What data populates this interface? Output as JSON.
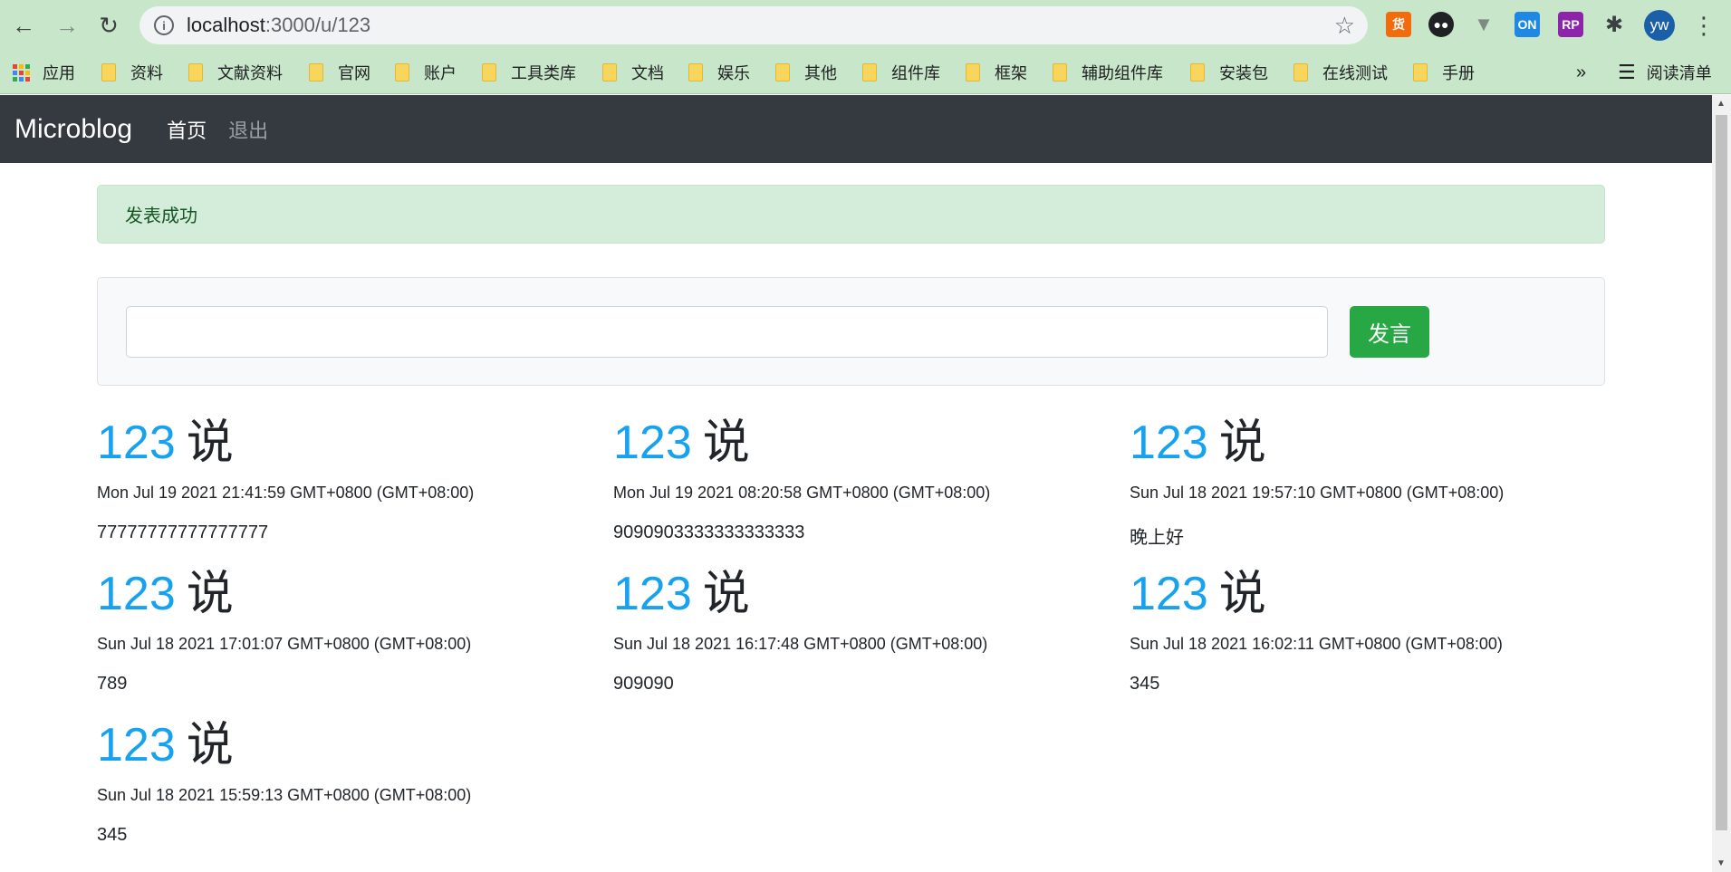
{
  "browser": {
    "url_host": "localhost",
    "url_path": ":3000/u/123",
    "avatar_initials": "yw",
    "extensions": [
      {
        "name": "货",
        "color": "#f26c0d"
      },
      {
        "name": "ON",
        "color": "#1e88e5"
      },
      {
        "name": "RP",
        "color": "#8e24aa"
      }
    ],
    "apps_label": "应用",
    "bookmarks": [
      "资料",
      "文献资料",
      "官网",
      "账户",
      "工具类库",
      "文档",
      "娱乐",
      "其他",
      "组件库",
      "框架",
      "辅助组件库",
      "安装包",
      "在线测试",
      "手册"
    ],
    "more_label": "»",
    "reading_list_label": "阅读清单"
  },
  "navbar": {
    "brand": "Microblog",
    "links": [
      "首页",
      "退出"
    ]
  },
  "alert": {
    "message": "发表成功"
  },
  "post_form": {
    "input_value": "",
    "button_label": "发言"
  },
  "posts": [
    {
      "user": "123",
      "says": "说",
      "time": "Mon Jul 19 2021 21:41:59 GMT+0800 (GMT+08:00)",
      "text": "77777777777777777"
    },
    {
      "user": "123",
      "says": "说",
      "time": "Mon Jul 19 2021 08:20:58 GMT+0800 (GMT+08:00)",
      "text": "9090903333333333333"
    },
    {
      "user": "123",
      "says": "说",
      "time": "Sun Jul 18 2021 19:57:10 GMT+0800 (GMT+08:00)",
      "text": "晚上好"
    },
    {
      "user": "123",
      "says": "说",
      "time": "Sun Jul 18 2021 17:01:07 GMT+0800 (GMT+08:00)",
      "text": "789"
    },
    {
      "user": "123",
      "says": "说",
      "time": "Sun Jul 18 2021 16:17:48 GMT+0800 (GMT+08:00)",
      "text": "909090"
    },
    {
      "user": "123",
      "says": "说",
      "time": "Sun Jul 18 2021 16:02:11 GMT+0800 (GMT+08:00)",
      "text": "345"
    },
    {
      "user": "123",
      "says": "说",
      "time": "Sun Jul 18 2021 15:59:13 GMT+0800 (GMT+08:00)",
      "text": "345"
    }
  ]
}
